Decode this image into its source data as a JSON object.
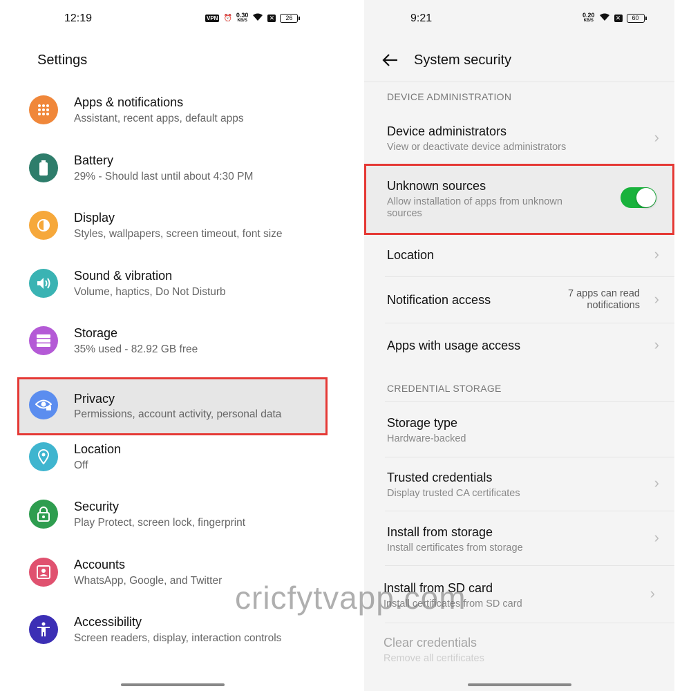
{
  "left": {
    "status": {
      "time": "12:19",
      "vpn": "VPN",
      "speed": "0.30",
      "speed_unit": "KB/S",
      "battery": "26"
    },
    "title": "Settings",
    "items": [
      {
        "title": "Apps & notifications",
        "subtitle": "Assistant, recent apps, default apps",
        "icon": "apps-grid-icon",
        "color": "#f0873a"
      },
      {
        "title": "Battery",
        "subtitle": "29% - Should last until about 4:30 PM",
        "icon": "battery-icon",
        "color": "#2e7d6b"
      },
      {
        "title": "Display",
        "subtitle": "Styles, wallpapers, screen timeout, font size",
        "icon": "brightness-icon",
        "color": "#f6a83b"
      },
      {
        "title": "Sound & vibration",
        "subtitle": "Volume, haptics, Do Not Disturb",
        "icon": "volume-icon",
        "color": "#3ab3b3"
      },
      {
        "title": "Storage",
        "subtitle": "35% used - 82.92 GB free",
        "icon": "storage-icon",
        "color": "#b45ad6"
      },
      {
        "title": "Privacy",
        "subtitle": "Permissions, account activity, personal data",
        "icon": "eye-lock-icon",
        "color": "#5b8def"
      },
      {
        "title": "Location",
        "subtitle": "Off",
        "icon": "location-pin-icon",
        "color": "#3fb5cf"
      },
      {
        "title": "Security",
        "subtitle": "Play Protect, screen lock, fingerprint",
        "icon": "lock-icon",
        "color": "#2e9d4f"
      },
      {
        "title": "Accounts",
        "subtitle": "WhatsApp, Google, and Twitter",
        "icon": "account-icon",
        "color": "#e0516f"
      },
      {
        "title": "Accessibility",
        "subtitle": "Screen readers, display, interaction controls",
        "icon": "accessibility-icon",
        "color": "#3c2fb5"
      }
    ]
  },
  "right": {
    "status": {
      "time": "9:21",
      "speed": "0.20",
      "speed_unit": "KB/S",
      "battery": "60"
    },
    "title": "System security",
    "section_device_admin": "DEVICE ADMINISTRATION",
    "device_administrators": {
      "title": "Device administrators",
      "subtitle": "View or deactivate device administrators"
    },
    "unknown_sources": {
      "title": "Unknown sources",
      "subtitle_line1": "Allow installation of apps from unknown",
      "subtitle_line2": "sources",
      "enabled": true
    },
    "location": {
      "title": "Location"
    },
    "notification_access": {
      "title": "Notification access",
      "note_line1": "7 apps can read",
      "note_line2": "notifications"
    },
    "usage_access": {
      "title": "Apps with usage access"
    },
    "section_credential": "CREDENTIAL STORAGE",
    "storage_type": {
      "title": "Storage type",
      "subtitle": "Hardware-backed"
    },
    "trusted_credentials": {
      "title": "Trusted credentials",
      "subtitle": "Display trusted CA certificates"
    },
    "install_storage": {
      "title": "Install from storage",
      "subtitle": "Install certificates from storage"
    },
    "install_sd": {
      "title": "Install from SD card",
      "subtitle": "Install certificates from SD card"
    },
    "clear_credentials": {
      "title": "Clear credentials",
      "subtitle": "Remove all certificates"
    }
  },
  "watermark": "cricfytvapp.com",
  "colors": {
    "highlight_border": "#e53935",
    "toggle_on": "#19b23c"
  }
}
